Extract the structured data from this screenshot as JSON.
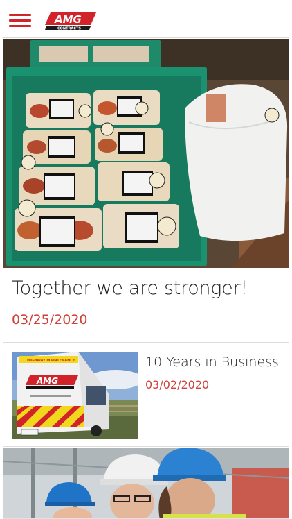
{
  "header": {
    "menu_icon": "hamburger-menu-icon",
    "logo_text": "AMG",
    "logo_subtext": "CONTRACTS",
    "accent_color": "#d2232a"
  },
  "posts": [
    {
      "title": "Together we are stronger!",
      "date": "03/25/2020",
      "image": "food-trays-photo"
    },
    {
      "title": "10 Years in Business",
      "date": "03/02/2020",
      "image": "amg-van-photo"
    },
    {
      "image": "hardhat-workers-photo"
    }
  ]
}
